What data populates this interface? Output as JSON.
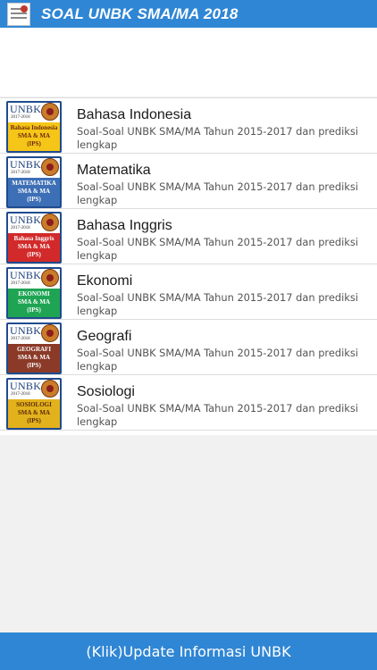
{
  "app": {
    "title": "SOAL UNBK SMA/MA 2018",
    "icon": "app-book-icon"
  },
  "subjects": [
    {
      "title": "Bahasa Indonesia",
      "description": "Soal-Soal UNBK SMA/MA Tahun 2015-2017 dan prediksi lengkap",
      "thumb": {
        "brand": "UNBK",
        "year": "2017-2018",
        "line1": "Bahasa Indonesia",
        "line2": "SMA & MA",
        "line3": "(IPS)",
        "color": "#f5c518"
      }
    },
    {
      "title": "Matematika",
      "description": "Soal-Soal UNBK SMA/MA Tahun 2015-2017 dan prediksi lengkap",
      "thumb": {
        "brand": "UNBK",
        "year": "2017-2018",
        "line1": "MATEMATIKA",
        "line2": "SMA & MA",
        "line3": "(IPS)",
        "color": "#3d6fb6"
      }
    },
    {
      "title": "Bahasa Inggris",
      "description": "Soal-Soal UNBK SMA/MA Tahun 2015-2017 dan prediksi lengkap",
      "thumb": {
        "brand": "UNBK",
        "year": "2017-2018",
        "line1": "Bahasa Inggris",
        "line2": "SMA & MA",
        "line3": "(IPS)",
        "color": "#d22a2a"
      }
    },
    {
      "title": "Ekonomi",
      "description": "Soal-Soal UNBK SMA/MA Tahun 2015-2017 dan prediksi lengkap",
      "thumb": {
        "brand": "UNBK",
        "year": "2017-2018",
        "line1": "EKONOMI",
        "line2": "SMA & MA",
        "line3": "(IPS)",
        "color": "#1fa454"
      }
    },
    {
      "title": "Geografi",
      "description": "Soal-Soal UNBK SMA/MA Tahun 2015-2017 dan prediksi lengkap",
      "thumb": {
        "brand": "UNBK",
        "year": "2017-2018",
        "line1": "GEOGRAFI",
        "line2": "SMA & MA",
        "line3": "(IPS)",
        "color": "#8b3a28"
      }
    },
    {
      "title": "Sosiologi",
      "description": "Soal-Soal UNBK SMA/MA Tahun 2015-2017 dan prediksi lengkap",
      "thumb": {
        "brand": "UNBK",
        "year": "2017-2018",
        "line1": "SOSIOLOGI",
        "line2": "SMA & MA",
        "line3": "(IPS)",
        "color": "#e2b21c"
      }
    }
  ],
  "footer": {
    "label": "(Klik)Update Informasi UNBK"
  },
  "colors": {
    "primary": "#2f86d4",
    "background": "#f1f1f1"
  }
}
